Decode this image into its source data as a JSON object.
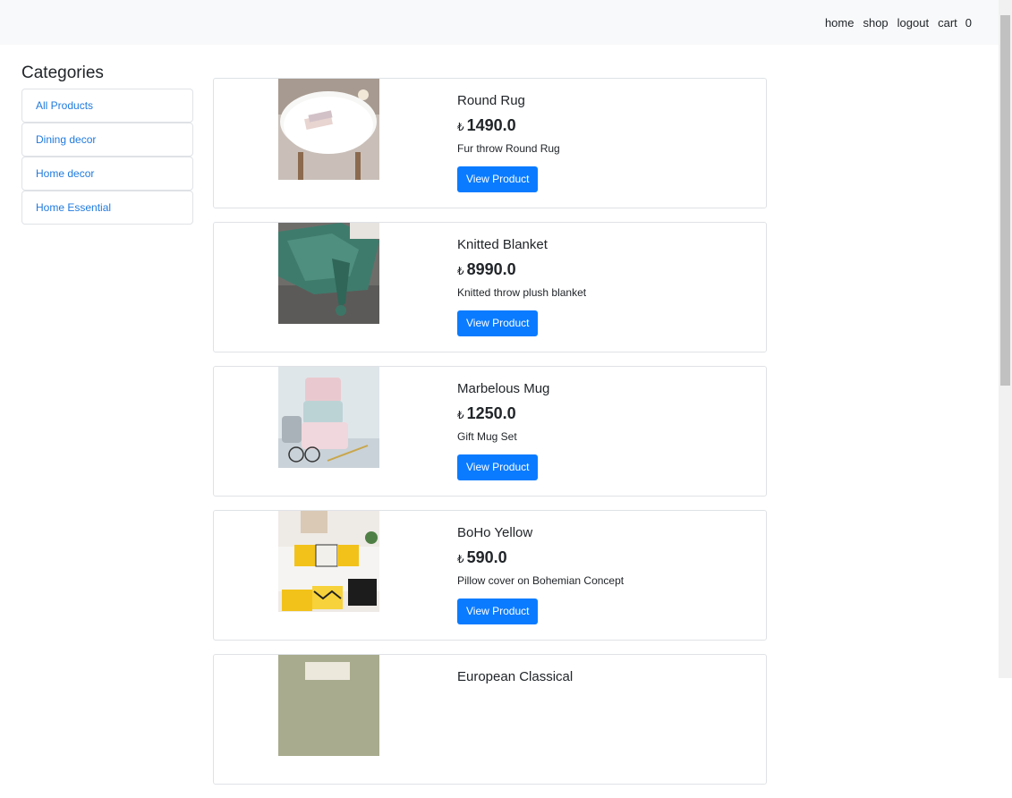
{
  "navbar": {
    "links": [
      "home",
      "shop",
      "logout",
      "cart"
    ],
    "cart_count": "0"
  },
  "sidebar": {
    "title": "Categories",
    "items": [
      "All Products",
      "Dining decor",
      "Home decor",
      "Home Essential"
    ]
  },
  "currency_symbol": "₺",
  "products": [
    {
      "name": "Round Rug",
      "price": "1490.0",
      "description": "Fur throw Round Rug",
      "button": "View Product",
      "image": "fur-rug-stool-image"
    },
    {
      "name": "Knitted Blanket",
      "price": "8990.0",
      "description": "Knitted throw plush blanket",
      "button": "View Product",
      "image": "knitted-blanket-image"
    },
    {
      "name": "Marbelous Mug",
      "price": "1250.0",
      "description": "Gift Mug Set",
      "button": "View Product",
      "image": "marble-mugs-image"
    },
    {
      "name": "BoHo Yellow",
      "price": "590.0",
      "description": "Pillow cover on Bohemian Concept",
      "button": "View Product",
      "image": "boho-pillows-image"
    },
    {
      "name": "European Classical",
      "price": "",
      "description": "",
      "button": "",
      "image": "european-classical-image"
    }
  ]
}
